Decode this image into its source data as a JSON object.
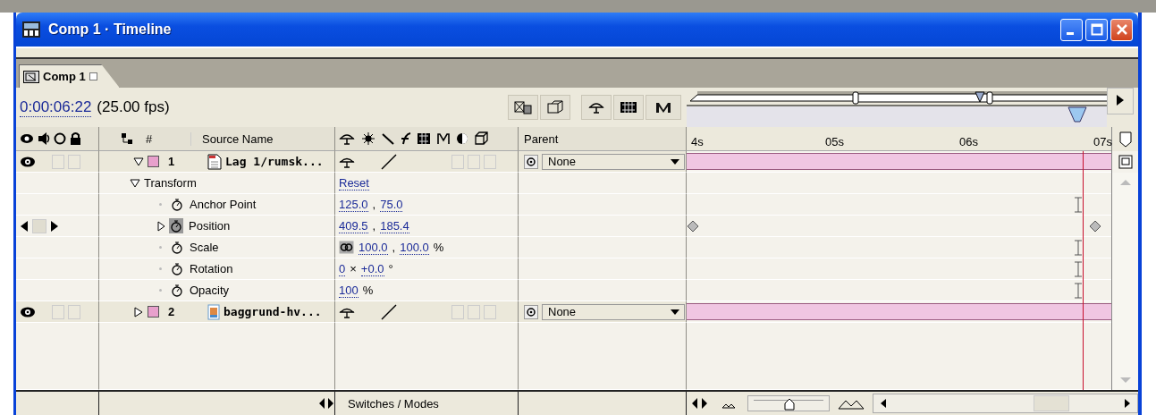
{
  "window": {
    "title": "Comp 1 · Timeline"
  },
  "tab": {
    "label": "Comp 1"
  },
  "timecode": "0:00:06:22",
  "fps": "(25.00 fps)",
  "columns": {
    "number": "#",
    "source_name": "Source Name",
    "parent": "Parent"
  },
  "ruler": [
    "4s",
    "05s",
    "06s",
    "07s"
  ],
  "layers": [
    {
      "number": "1",
      "name": "Lag 1/rumsk...",
      "kind": "document",
      "visible": true,
      "solo": false,
      "locked": false,
      "motion_blur": false,
      "adjustment": false,
      "three_d": false,
      "expanded": true,
      "color": "#e8a0cc",
      "parent": "None",
      "transform": {
        "label": "Transform",
        "action": "Reset",
        "expanded": true,
        "properties": [
          {
            "name": "Anchor Point",
            "animated": false,
            "values": [
              "125.0",
              "75.0"
            ],
            "separator": ","
          },
          {
            "name": "Position",
            "animated": true,
            "at_keyframe": false,
            "values": [
              "409.5",
              "185.4"
            ],
            "separator": ","
          },
          {
            "name": "Scale",
            "animated": false,
            "constrain": true,
            "values": [
              "100.0",
              "100.0"
            ],
            "separator": ",",
            "unit": "%"
          },
          {
            "name": "Rotation",
            "animated": false,
            "values": [
              "0",
              "+0.0"
            ],
            "separator": "×",
            "unit": "°"
          },
          {
            "name": "Opacity",
            "animated": false,
            "values": [
              "100"
            ],
            "unit": "%"
          }
        ]
      }
    },
    {
      "number": "2",
      "name": "baggrund-hv...",
      "kind": "image",
      "visible": true,
      "solo": false,
      "locked": false,
      "motion_blur": false,
      "adjustment": false,
      "three_d": false,
      "expanded": false,
      "color": "#e8a0cc",
      "parent": "None"
    }
  ],
  "switches_modes": "Switches / Modes",
  "zoom": {
    "level": 0.5
  }
}
